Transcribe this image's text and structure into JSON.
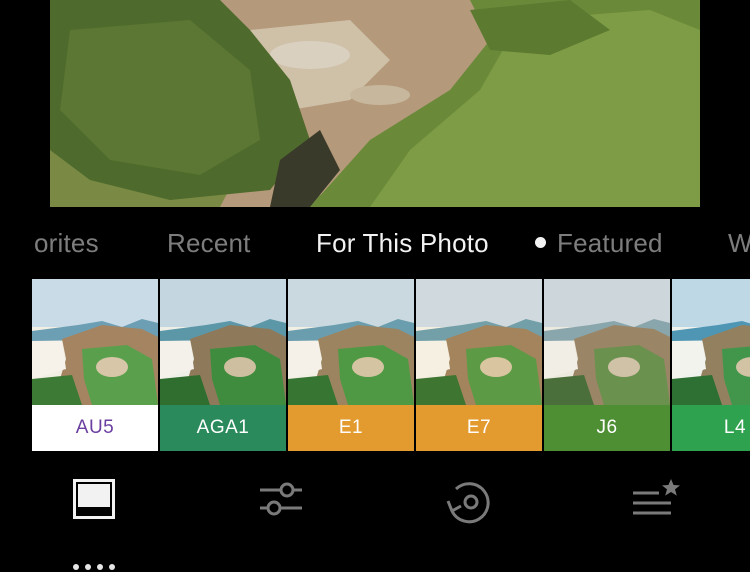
{
  "tabs": [
    {
      "label": "orites",
      "active": false
    },
    {
      "label": "Recent",
      "active": false
    },
    {
      "label": "For This Photo",
      "active": true
    },
    {
      "label": "Featured",
      "active": false
    },
    {
      "label": "W",
      "active": false
    }
  ],
  "presets": [
    {
      "label": "AU5",
      "bg": "#ffffff",
      "fg": "#6b3fa0"
    },
    {
      "label": "AGA1",
      "bg": "#2a8a5c",
      "fg": "#ffffff"
    },
    {
      "label": "E1",
      "bg": "#e39a2e",
      "fg": "#ffffff"
    },
    {
      "label": "E7",
      "bg": "#e39a2e",
      "fg": "#ffffff"
    },
    {
      "label": "J6",
      "bg": "#4e8f33",
      "fg": "#ffffff"
    },
    {
      "label": "L4",
      "bg": "#2fa24f",
      "fg": "#ffffff"
    }
  ],
  "toolbar": {
    "items": [
      {
        "icon": "presets-icon",
        "active": true
      },
      {
        "icon": "adjust-sliders-icon",
        "active": false
      },
      {
        "icon": "history-icon",
        "active": false
      },
      {
        "icon": "recipes-list-star-icon",
        "active": false
      }
    ]
  }
}
